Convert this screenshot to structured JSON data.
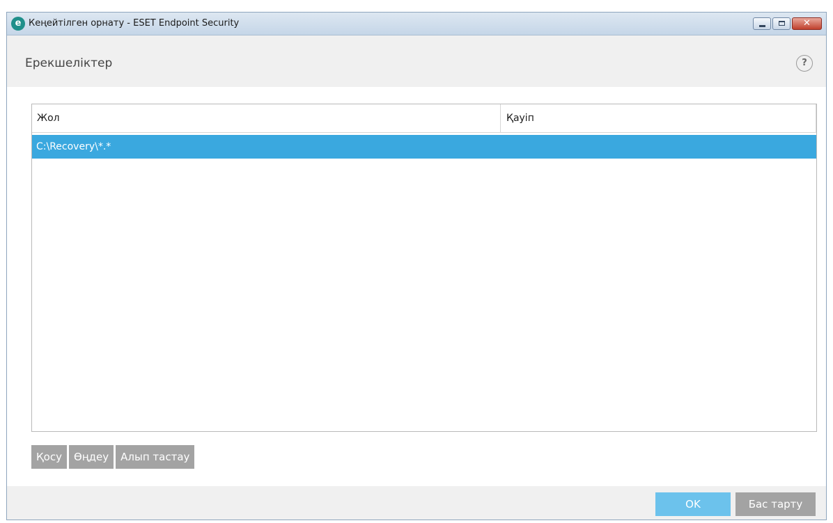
{
  "window": {
    "title": "Кеңейтілген орнату - ESET Endpoint Security",
    "logo_letter": "e",
    "minimize_icon": "minimize-icon",
    "maximize_icon": "maximize-icon",
    "close_glyph": "✕"
  },
  "header": {
    "title": "Ерекшеліктер",
    "help_glyph": "?"
  },
  "list": {
    "columns": [
      "Жол",
      "Қауіп"
    ],
    "rows": [
      {
        "path": "C:\\Recovery\\*.*",
        "threat": "",
        "selected": true
      }
    ]
  },
  "actions": {
    "add": "Қосу",
    "edit": "Өңдеу",
    "remove": "Алып тастау"
  },
  "footer": {
    "ok": "OK",
    "cancel": "Бас тарту"
  },
  "colors": {
    "selection": "#3aa8df",
    "primary_button": "#6cc2ec",
    "secondary_button": "#a3a3a3",
    "header_bg": "#f0f0f0"
  }
}
